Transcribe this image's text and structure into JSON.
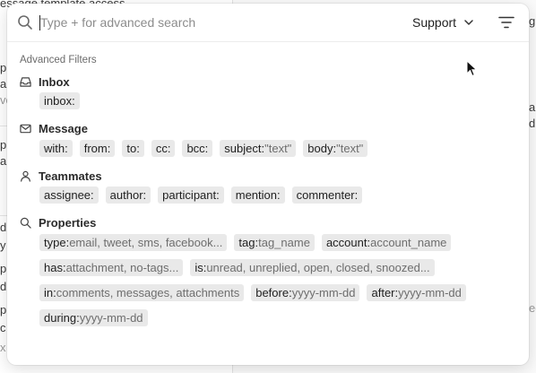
{
  "background": {
    "fragments": [
      "essage template access",
      "p",
      "a",
      "vo",
      "p",
      "a",
      "d",
      "y",
      "p",
      "d",
      "p",
      "c",
      "x",
      "g",
      "ar",
      "d",
      "ec"
    ]
  },
  "search": {
    "placeholder": "Type + for advanced search",
    "value": "",
    "scope_label": "Support"
  },
  "advanced_filters": {
    "title": "Advanced Filters",
    "inbox": {
      "label": "Inbox",
      "chips": [
        {
          "key": "inbox:",
          "value": ""
        }
      ]
    },
    "message": {
      "label": "Message",
      "chips": [
        {
          "key": "with:",
          "value": ""
        },
        {
          "key": "from:",
          "value": ""
        },
        {
          "key": "to:",
          "value": ""
        },
        {
          "key": "cc:",
          "value": ""
        },
        {
          "key": "bcc:",
          "value": ""
        },
        {
          "key": "subject:",
          "value": "\"text\""
        },
        {
          "key": "body:",
          "value": "\"text\""
        }
      ]
    },
    "teammates": {
      "label": "Teammates",
      "chips": [
        {
          "key": "assignee:",
          "value": ""
        },
        {
          "key": "author:",
          "value": ""
        },
        {
          "key": "participant:",
          "value": ""
        },
        {
          "key": "mention:",
          "value": ""
        },
        {
          "key": "commenter:",
          "value": ""
        }
      ]
    },
    "properties": {
      "label": "Properties",
      "rows": [
        [
          {
            "key": "type:",
            "value": "email, tweet, sms, facebook..."
          },
          {
            "key": "tag:",
            "value": "tag_name"
          },
          {
            "key": "account:",
            "value": "account_name"
          }
        ],
        [
          {
            "key": "has:",
            "value": "attachment, no-tags..."
          },
          {
            "key": "is:",
            "value": "unread, unreplied, open, closed, snoozed..."
          }
        ],
        [
          {
            "key": "in:",
            "value": "comments, messages, attachments"
          },
          {
            "key": "before:",
            "value": "yyyy-mm-dd"
          },
          {
            "key": "after:",
            "value": "yyyy-mm-dd"
          }
        ],
        [
          {
            "key": "during:",
            "value": "yyyy-mm-dd"
          }
        ]
      ]
    }
  },
  "icons": {
    "search": "search-icon",
    "scope_chevron": "chevron-down-icon",
    "filter": "filter-lines-icon",
    "inbox": "inbox-tray-icon",
    "message": "envelope-icon",
    "teammates": "person-icon",
    "properties": "magnifier-icon",
    "pointer": "mouse-pointer-icon"
  },
  "colors": {
    "chip_bg": "#e9e9e9",
    "chip_value_text": "#6e6e6e",
    "section_text": "#2b2b2b"
  }
}
